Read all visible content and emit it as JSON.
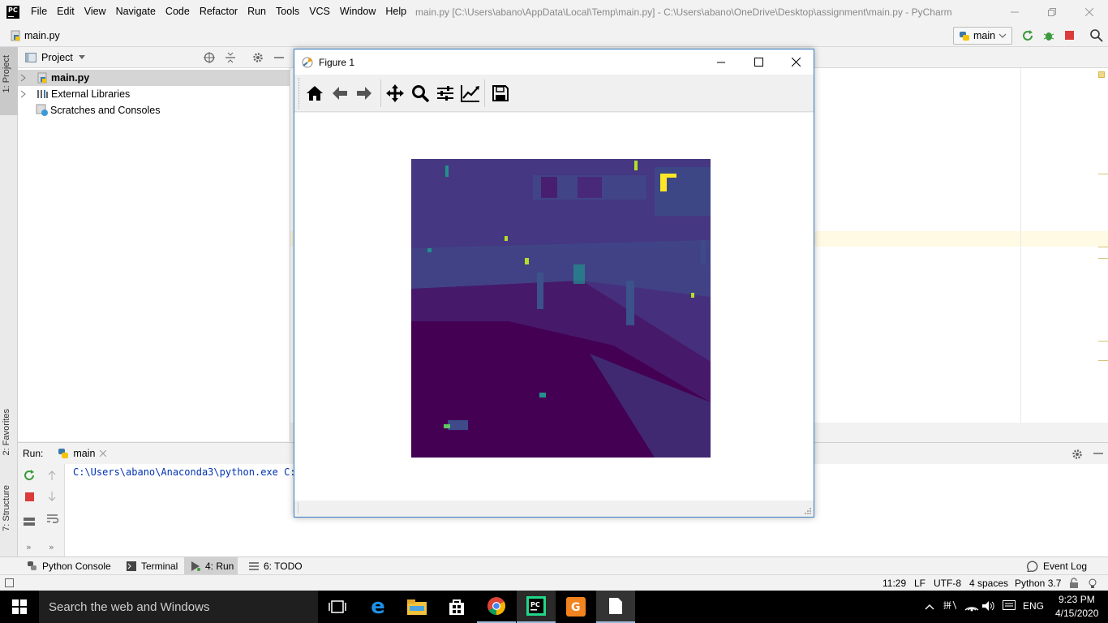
{
  "window": {
    "title": "main.py [C:\\Users\\abano\\AppData\\Local\\Temp\\main.py] - C:\\Users\\abano\\OneDrive\\Desktop\\assignment\\main.py - PyCharm",
    "logo": "PC"
  },
  "menu": [
    "File",
    "Edit",
    "View",
    "Navigate",
    "Code",
    "Refactor",
    "Run",
    "Tools",
    "VCS",
    "Window",
    "Help"
  ],
  "navbar": {
    "file": "main.py",
    "run_config": "main"
  },
  "left_strip": {
    "project_tab": "1: Project",
    "favorites_tab": "2: Favorites",
    "structure_tab": "7: Structure"
  },
  "project": {
    "title": "Project",
    "items": [
      {
        "label": "main.py",
        "icon": "python-file-icon"
      },
      {
        "label": "External Libraries",
        "icon": "library-icon"
      },
      {
        "label": "Scratches and Consoles",
        "icon": "scratches-icon"
      }
    ]
  },
  "run_panel": {
    "label": "Run:",
    "tab": "main",
    "console_line": "C:\\Users\\abano\\Anaconda3\\python.exe C:/"
  },
  "bottom_tabs": {
    "python_console": "Python Console",
    "terminal": "Terminal",
    "run": "4: Run",
    "todo": "6: TODO",
    "event_log": "Event Log"
  },
  "status": {
    "position": "11:29",
    "line_sep": "LF",
    "encoding": "UTF-8",
    "indent": "4 spaces",
    "interpreter": "Python 3.7"
  },
  "figure": {
    "title": "Figure 1",
    "tools": [
      "home-icon",
      "back-arrow-icon",
      "forward-arrow-icon",
      "pan-icon",
      "zoom-icon",
      "configure-subplots-icon",
      "edit-axes-icon",
      "save-icon"
    ]
  },
  "taskbar": {
    "search_placeholder": "Search the web and Windows",
    "language": "ENG",
    "time": "9:23 PM",
    "date": "4/15/2020"
  },
  "colors": {
    "accent": "#3b7fc4",
    "viridis_dark": "#440154",
    "viridis_mid": "#3b528b",
    "viridis_yellow": "#fde725"
  }
}
